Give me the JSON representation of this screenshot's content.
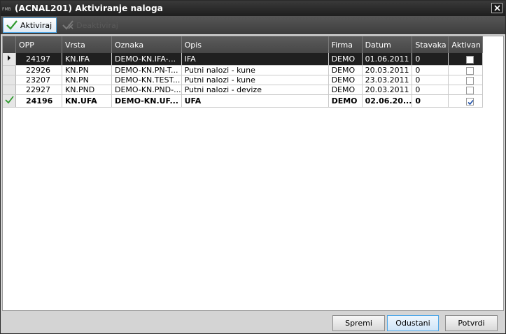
{
  "window": {
    "title": "(ACNAL201) Aktiviranje naloga",
    "app_icon": "fmb-logo-icon",
    "close_icon": "close-icon"
  },
  "toolbar": {
    "activate_label": "Aktiviraj",
    "deactivate_label": "Deaktiviraj"
  },
  "grid": {
    "columns": [
      "OPP",
      "Vrsta",
      "Oznaka",
      "Opis",
      "Firma",
      "Datum",
      "Stavaka",
      "Aktivan"
    ],
    "rows": [
      {
        "opp": "24197",
        "vrsta": "KN.IFA",
        "oznaka": "DEMO-KN.IFA-...",
        "opis": "IFA",
        "firma": "DEMO",
        "datum": "01.06.2011",
        "stavaka": "0",
        "aktivan": false,
        "selected": true,
        "bold": false
      },
      {
        "opp": "22926",
        "vrsta": "KN.PN",
        "oznaka": "DEMO-KN.PN-T...",
        "opis": "Putni nalozi - kune",
        "firma": "DEMO",
        "datum": "20.03.2011",
        "stavaka": "0",
        "aktivan": false,
        "selected": false,
        "bold": false
      },
      {
        "opp": "23207",
        "vrsta": "KN.PN",
        "oznaka": "DEMO-KN.TEST...",
        "opis": "Putni nalozi - kune",
        "firma": "DEMO",
        "datum": "23.03.2011",
        "stavaka": "0",
        "aktivan": false,
        "selected": false,
        "bold": false
      },
      {
        "opp": "22927",
        "vrsta": "KN.PND",
        "oznaka": "DEMO-KN.PND-...",
        "opis": "Putni nalozi - devize",
        "firma": "DEMO",
        "datum": "20.03.2011",
        "stavaka": "0",
        "aktivan": false,
        "selected": false,
        "bold": false
      },
      {
        "opp": "24196",
        "vrsta": "KN.UFA",
        "oznaka": "DEMO-KN.UF...",
        "opis": "UFA",
        "firma": "DEMO",
        "datum": "02.06.20...",
        "stavaka": "0",
        "aktivan": true,
        "selected": false,
        "bold": true
      }
    ]
  },
  "footer": {
    "save_label": "Spremi",
    "cancel_label": "Odustani",
    "confirm_label": "Potvrdi"
  },
  "colors": {
    "titlebar": "#1e1e1e",
    "toolbar": "#464646",
    "accent": "#4fa7e6",
    "check_green": "#2f9a2f"
  }
}
